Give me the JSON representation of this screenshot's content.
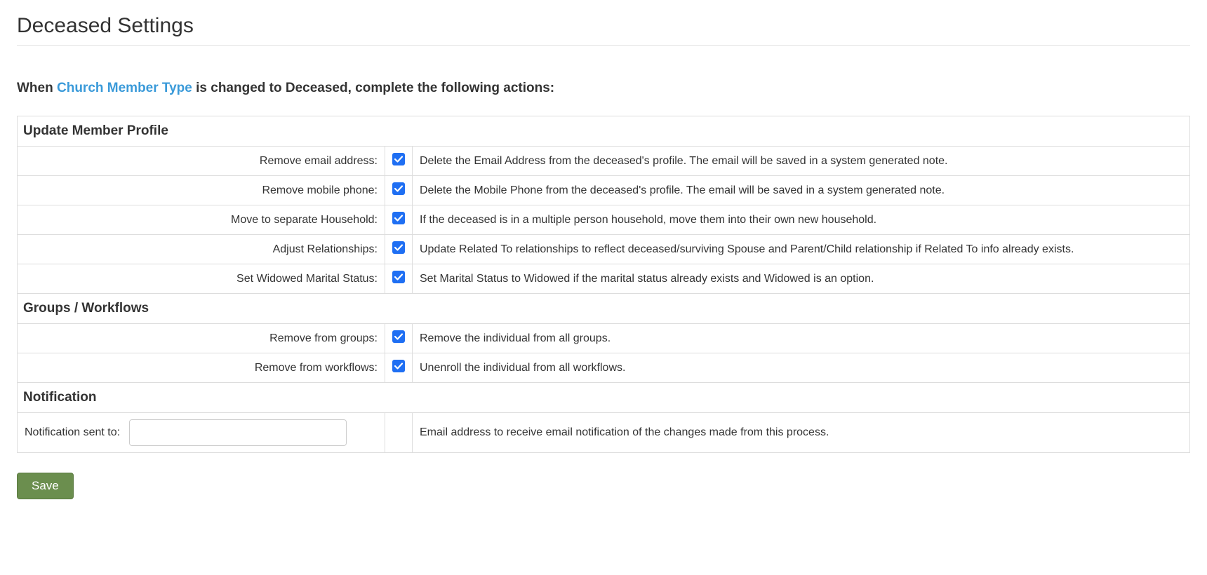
{
  "title": "Deceased Settings",
  "intro": {
    "prefix": "When ",
    "link": "Church Member Type",
    "suffix": " is changed to Deceased, complete the following actions:"
  },
  "sections": {
    "update_member_profile": {
      "header": "Update Member Profile",
      "rows": [
        {
          "label": "Remove email address:",
          "checked": true,
          "desc": "Delete the Email Address from the deceased's profile. The email will be saved in a system generated note."
        },
        {
          "label": "Remove mobile phone:",
          "checked": true,
          "desc": "Delete the Mobile Phone from the deceased's profile. The email will be saved in a system generated note."
        },
        {
          "label": "Move to separate Household:",
          "checked": true,
          "desc": "If the deceased is in a multiple person household, move them into their own new household."
        },
        {
          "label": "Adjust Relationships:",
          "checked": true,
          "desc": "Update Related To relationships to reflect deceased/surviving Spouse and Parent/Child relationship if Related To info already exists."
        },
        {
          "label": "Set Widowed Marital Status:",
          "checked": true,
          "desc": "Set Marital Status to Widowed if the marital status already exists and Widowed is an option."
        }
      ]
    },
    "groups_workflows": {
      "header": "Groups / Workflows",
      "rows": [
        {
          "label": "Remove from groups:",
          "checked": true,
          "desc": "Remove the individual from all groups."
        },
        {
          "label": "Remove from workflows:",
          "checked": true,
          "desc": "Unenroll the individual from all workflows."
        }
      ]
    },
    "notification": {
      "header": "Notification",
      "label": "Notification sent to:",
      "value": "",
      "desc": "Email address to receive email notification of the changes made from this process."
    }
  },
  "save_label": "Save"
}
